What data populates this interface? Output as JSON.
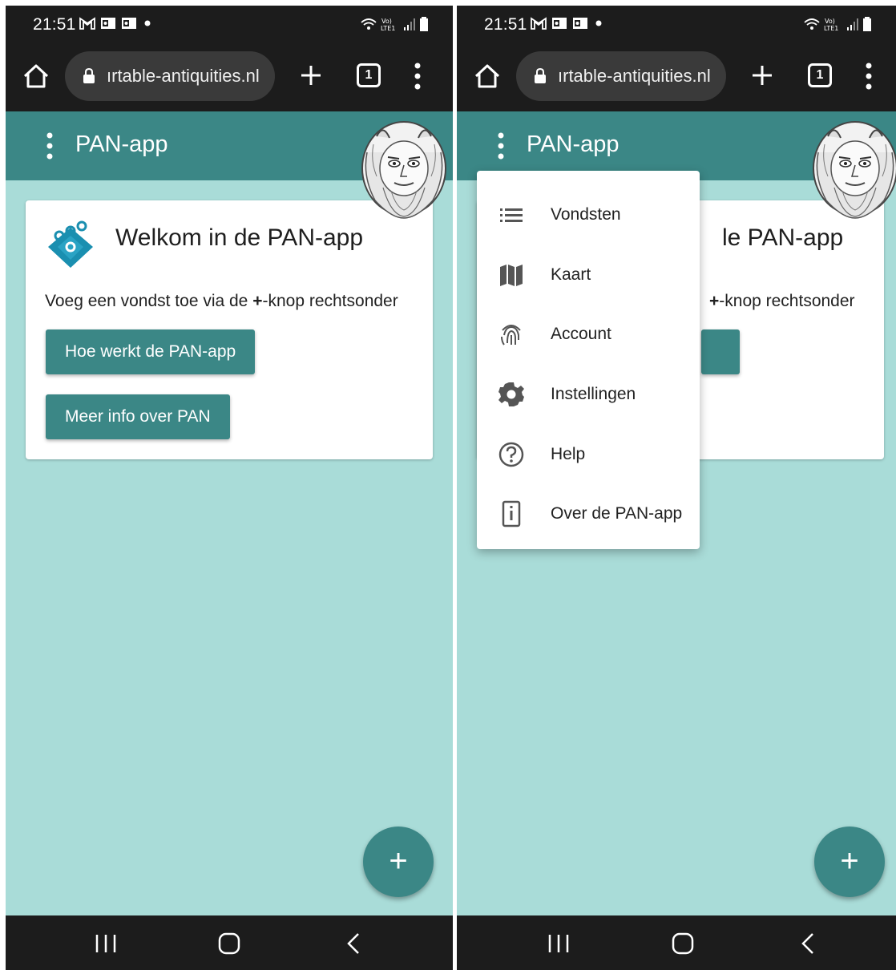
{
  "status_bar": {
    "time": "21:51",
    "notification_icons": [
      "gmail-icon",
      "outlook-icon",
      "outlook-icon",
      "dot-icon"
    ],
    "system_icons": [
      "wifi-calling-icon",
      "volte-lte-icon",
      "signal-icon",
      "battery-icon"
    ]
  },
  "browser": {
    "url": "ırtable-antiquities.nl",
    "tab_count": "1"
  },
  "app": {
    "menu_icon": "more-vert-icon",
    "title": "PAN-app",
    "mascot": "pan-faun-mascot"
  },
  "card": {
    "title": "Welkom in de PAN-app",
    "text_before": "Voeg een vondst toe via de ",
    "text_bold": "+",
    "text_after": "-knop rechtsonder",
    "buttons": [
      "Hoe werkt de PAN-app",
      "Meer info over PAN"
    ]
  },
  "fab": {
    "label": "+"
  },
  "right_screen": {
    "card_title_visible": "le PAN-app",
    "card_text_visible": "+",
    "card_text_after": "-knop rechtsonder",
    "menu": [
      {
        "label": "Vondsten",
        "icon": "list-icon"
      },
      {
        "label": "Kaart",
        "icon": "map-icon"
      },
      {
        "label": "Account",
        "icon": "fingerprint-icon"
      },
      {
        "label": "Instellingen",
        "icon": "settings-gear-icon"
      },
      {
        "label": "Help",
        "icon": "help-circle-icon"
      },
      {
        "label": "Over de PAN-app",
        "icon": "info-icon"
      }
    ]
  },
  "colors": {
    "appbar": "#3b8786",
    "background": "#a9dcd8",
    "browser_chrome": "#1c1c1c",
    "card": "#ffffff"
  }
}
